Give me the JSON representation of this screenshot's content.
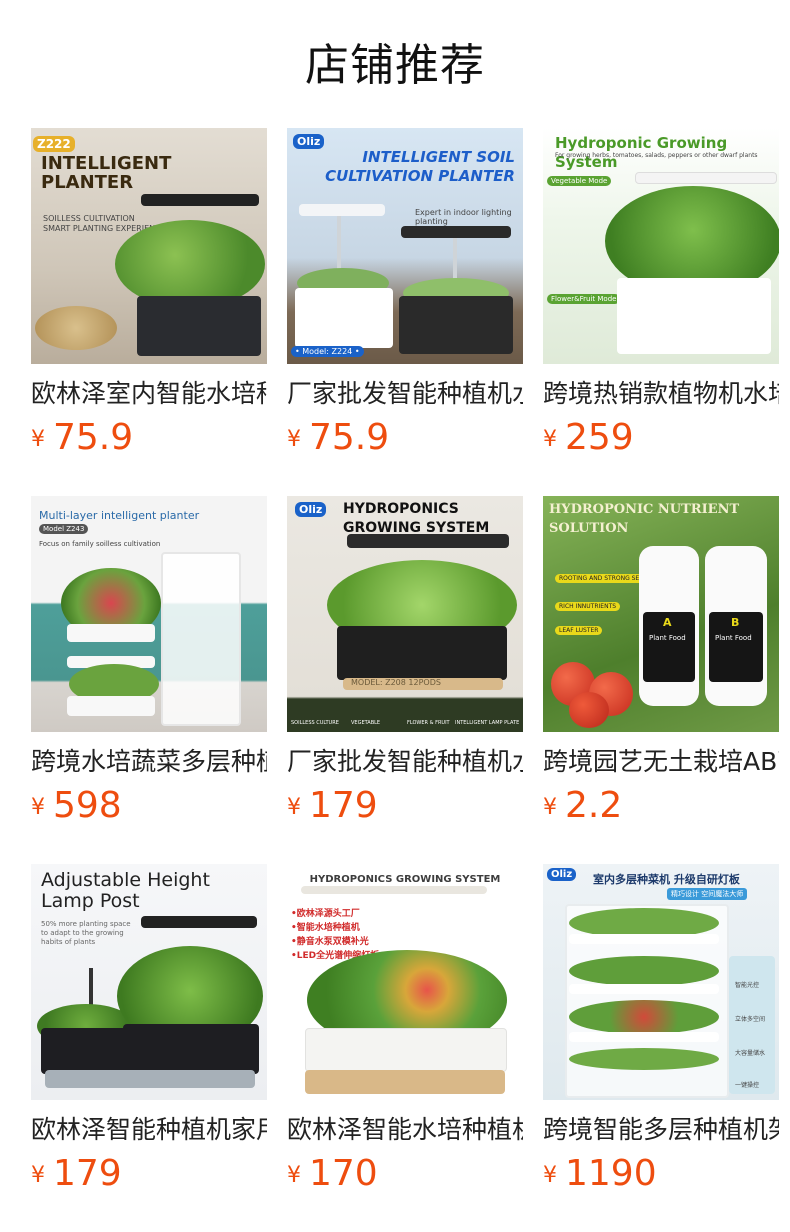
{
  "page": {
    "title": "店铺推荐"
  },
  "products": [
    {
      "name": "欧林泽室内智能水培种植机",
      "currency": "¥",
      "price": "75.9",
      "image": {
        "texts": [
          "Z222",
          "INTELLIGENT",
          "PLANTER",
          "SOILLESS CULTIVATION",
          "SMART PLANTING EXPERIENCE"
        ],
        "colors": {
          "bg": "#d9d2c6",
          "tank": "#2a2c30",
          "greens": "#5f9b3a",
          "lamp": "#222222"
        }
      }
    },
    {
      "name": "厂家批发智能种植机水培",
      "currency": "¥",
      "price": "75.9",
      "image": {
        "texts": [
          "Oliz",
          "INTELLIGENT SOIL",
          "CULTIVATION PLANTER",
          "Expert in indoor lighting planting",
          "• Model: Z224 •"
        ],
        "colors": {
          "bg": "#cfe0ef",
          "tank": "#ffffff",
          "greens": "#74a85a",
          "lamp": "#f4f6f8"
        }
      }
    },
    {
      "name": "跨境热销款植物机水培",
      "currency": "¥",
      "price": "259",
      "image": {
        "texts": [
          "Hydroponic Growing System",
          "For growing herbs, tomatoes, salads, peppers or other dwarf plants",
          "Vegetable Mode",
          "Flower&Fruit Mode"
        ],
        "colors": {
          "bg": "#eaf3e6",
          "tank": "#ffffff",
          "greens": "#4e8f2e",
          "lamp": "#f5f5f5"
        }
      }
    },
    {
      "name": "跨境水培蔬菜多层种植架",
      "currency": "¥",
      "price": "598",
      "image": {
        "texts": [
          "Multi-layer intelligent planter",
          "Model Z243",
          "Focus on family soilless cultivation"
        ],
        "colors": {
          "bg": "#dde8ea",
          "tank": "#f8f8f8",
          "greens": "#6aa33e",
          "lamp": "#ffffff"
        }
      }
    },
    {
      "name": "厂家批发智能种植机水培",
      "currency": "¥",
      "price": "179",
      "image": {
        "texts": [
          "Oliz",
          "HYDROPONICS",
          "GROWING SYSTEM",
          "MODEL: Z208 12PODS",
          "SOILLESS CULTURE",
          "VEGETABLE",
          "FLOWER & FRUIT",
          "INTELLIGENT LAMP PLATE"
        ],
        "colors": {
          "bg": "#e6e2da",
          "tank": "#1f1f1f",
          "greens": "#7cb84a",
          "lamp": "#2b2b2b"
        }
      }
    },
    {
      "name": "跨境园艺无土栽培AB营养液",
      "currency": "¥",
      "price": "2.2",
      "image": {
        "texts": [
          "HYDROPONIC NUTRIENT",
          "SOLUTION",
          "ROOTING AND STRONG SEEDLING",
          "RICH INNUTRIENTS",
          "LEAF LUSTER",
          "A",
          "B",
          "Plant Food"
        ],
        "colors": {
          "bg": "#5e8d3a",
          "tank": "#ffffff",
          "greens": "#d8392b",
          "lamp": "#e9d91a"
        }
      }
    },
    {
      "name": "欧林泽智能种植机家用",
      "currency": "¥",
      "price": "179",
      "image": {
        "texts": [
          "Adjustable Height",
          "Lamp Post",
          "50% more planting space",
          "to adapt to the growing",
          "habits of plants"
        ],
        "colors": {
          "bg": "#f2f3f5",
          "tank": "#1e1e22",
          "greens": "#4f8a2f",
          "lamp": "#222222"
        }
      }
    },
    {
      "name": "欧林泽智能水培种植机",
      "currency": "¥",
      "price": "170",
      "image": {
        "texts": [
          "HYDROPONICS GROWING SYSTEM",
          "•欧林泽源头工厂",
          "•智能水培种植机",
          "•静音水泵双模补光",
          "•LED全光谱伸缩灯板"
        ],
        "colors": {
          "bg": "#ffffff",
          "tank": "#f4f4f2",
          "greens": "#4f9a33",
          "lamp": "#e9e6df"
        }
      }
    },
    {
      "name": "跨境智能多层种植机架",
      "currency": "¥",
      "price": "1190",
      "image": {
        "texts": [
          "Oliz",
          "室内多层种菜机 升级自研灯板",
          "精巧设计 空间魔法大师",
          "智能光控",
          "立体多空间",
          "大容量储水",
          "一键操控"
        ],
        "colors": {
          "bg": "#dfe9ee",
          "tank": "#ffffff",
          "greens": "#5f9e3a",
          "lamp": "#ffffff"
        }
      }
    }
  ]
}
